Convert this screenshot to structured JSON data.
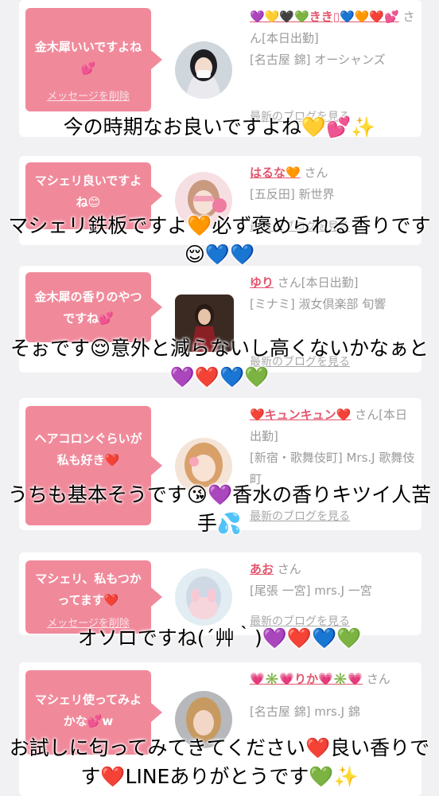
{
  "cards": [
    {
      "message": "金木犀いいですよね💕",
      "delete_label": "メッセージを削除",
      "name": "💜💛🖤💚きき▯💙🧡❤️💕",
      "suffix": " さん[本日出勤]",
      "shop": "[名古屋 錦] オーシャンズ",
      "blog": "最新のブログを見る",
      "caption": "今の時期なお良いですよね💛💕✨"
    },
    {
      "message": "マシェリ良いですよね😊",
      "name": "はるな🧡",
      "suffix": " さん",
      "shop": "[五反田] 新世界",
      "blog": "最新のブログを見る",
      "caption": "マシェリ鉄板ですよ🧡必ず褒められる香りです😌💙💙"
    },
    {
      "message": "金木犀の香りのやつですね💕",
      "name": "ゆり",
      "suffix": " さん[本日出勤]",
      "shop": "[ミナミ] 淑女倶楽部 旬響",
      "blog": "最新のブログを見る",
      "caption": "そぉです😌意外と減らないし高くないかなぁと💜❤️💙💚"
    },
    {
      "message": "ヘアコロンぐらいが私も好き❤️",
      "name": "❤️キュンキュン❤️",
      "suffix": " さん[本日出勤]",
      "shop": "[新宿・歌舞伎町] Mrs.J 歌舞伎町",
      "blog": "最新のブログを見る",
      "caption": "うちも基本そうです😘💜香水の香りキツイ人苦手💦"
    },
    {
      "message": "マシェリ、私もつかってます❤️",
      "delete_label": "メッセージを削除",
      "name": "あお",
      "suffix": " さん",
      "shop": "[尾張 一宮] mrs.J 一宮",
      "blog": "最新のブログを見る",
      "caption": "オソロですね(´艸｀)💜❤️💙💚"
    },
    {
      "message": "マシェリ使ってみよかな💕w",
      "name": "💗✳️💗りか💗✳️💗",
      "suffix": " さん",
      "shop": "[名古屋 錦] mrs.J 錦",
      "caption": "お試しに匂ってみてきてください❤️良い香りです❤️LINEありがとうです💚✨"
    }
  ],
  "colors": {
    "bubble": "#f08a9b",
    "name": "#e2566d",
    "muted": "#9b9b9b",
    "background": "#f1f1f3"
  }
}
